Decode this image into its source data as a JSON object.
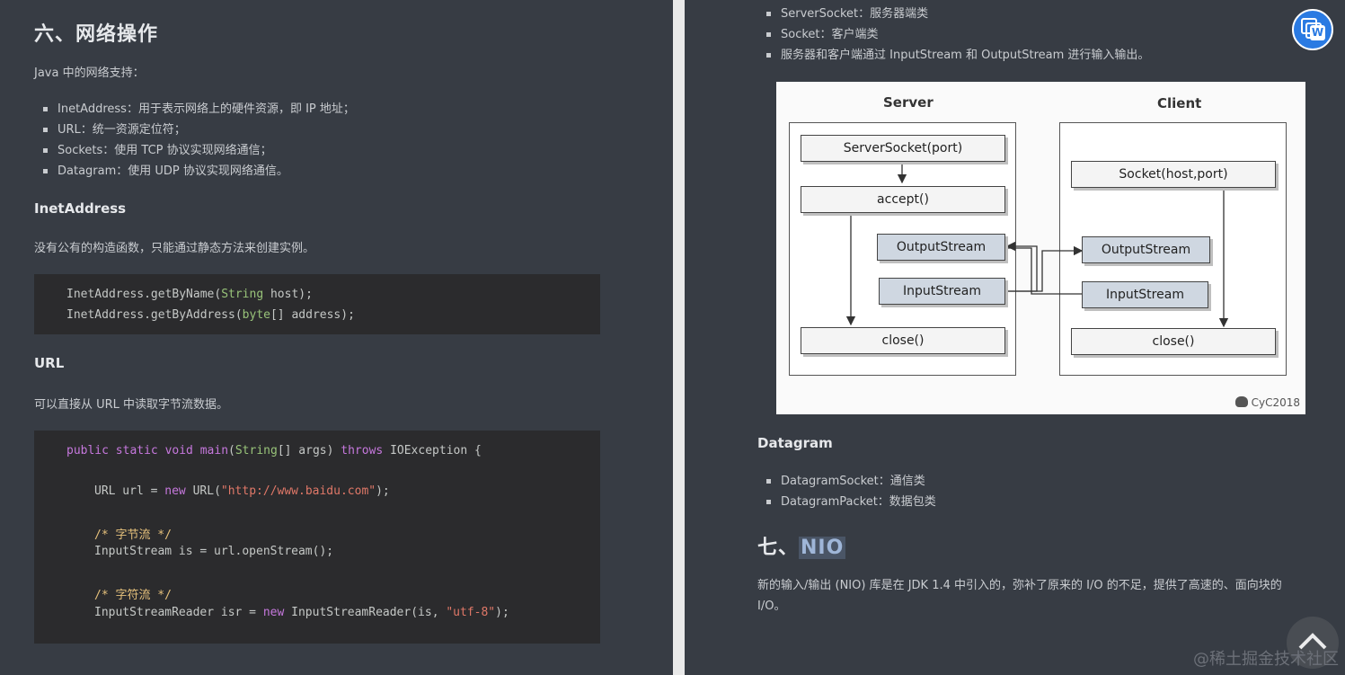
{
  "left": {
    "heading": "六、网络操作",
    "intro": "Java 中的网络支持：",
    "list": [
      "InetAddress：用于表示网络上的硬件资源，即 IP 地址；",
      "URL：统一资源定位符；",
      "Sockets：使用 TCP 协议实现网络通信；",
      "Datagram：使用 UDP 协议实现网络通信。"
    ],
    "inet_heading": "InetAddress",
    "inet_text": "没有公有的构造函数，只能通过静态方法来创建实例。",
    "inet_code": {
      "line1": {
        "a": "InetAddress.getByName(",
        "b": "String",
        "c": " host);"
      },
      "line2": {
        "a": "InetAddress.getByAddress(",
        "b": "byte",
        "c": "[] address);"
      }
    },
    "url_heading": "URL",
    "url_text": "可以直接从 URL 中读取字节流数据。",
    "url_code": {
      "l1": {
        "a": "public static void ",
        "b": "main",
        "c": "(",
        "d": "String",
        "e": "[] args) ",
        "f": "throws",
        "g": " IOException {"
      },
      "l2": {
        "a": "URL url = ",
        "b": "new",
        "c": " URL(",
        "d": "\"http://www.baidu.com\"",
        "e": ");"
      },
      "l3": "/* 字节流 */",
      "l4": "InputStream is = url.openStream();",
      "l5": "/* 字符流 */",
      "l6": {
        "a": "InputStreamReader isr = ",
        "b": "new",
        "c": " InputStreamReader(is, ",
        "d": "\"utf-8\"",
        "e": ");"
      }
    }
  },
  "right": {
    "list": [
      "ServerSocket：服务器端类",
      "Socket：客户端类",
      "服务器和客户端通过 InputStream 和 OutputStream 进行输入输出。"
    ],
    "diagram": {
      "server_title": "Server",
      "client_title": "Client",
      "server_socket": "ServerSocket(port)",
      "accept": "accept()",
      "server_output": "OutputStream",
      "server_input": "InputStream",
      "server_close": "close()",
      "client_socket": "Socket(host,port)",
      "client_output": "OutputStream",
      "client_input": "InputStream",
      "client_close": "close()",
      "credit": "CyC2018"
    },
    "datagram_heading": "Datagram",
    "datagram_list": [
      "DatagramSocket：通信类",
      "DatagramPacket：数据包类"
    ],
    "nio_heading_prefix": "七、",
    "nio_heading_link": "NIO",
    "nio_text_1": "新的输入/输出 (NIO) 库是在 JDK 1.4 中引入的，弥补了原来的 I/O 的不足，提供了高速的、面向块的",
    "nio_text_2": "I/O。"
  },
  "watermark": "@稀土掘金技术社区",
  "icons": {
    "word": "word-app-icon",
    "scroll": "chevron-up-icon"
  },
  "colors": {
    "page_bg": "#373c44",
    "code_bg": "#2b2b2d",
    "keyword": "#c678dd",
    "type": "#56b6c2",
    "string": "#e07868",
    "comment": "#e5c07b"
  }
}
